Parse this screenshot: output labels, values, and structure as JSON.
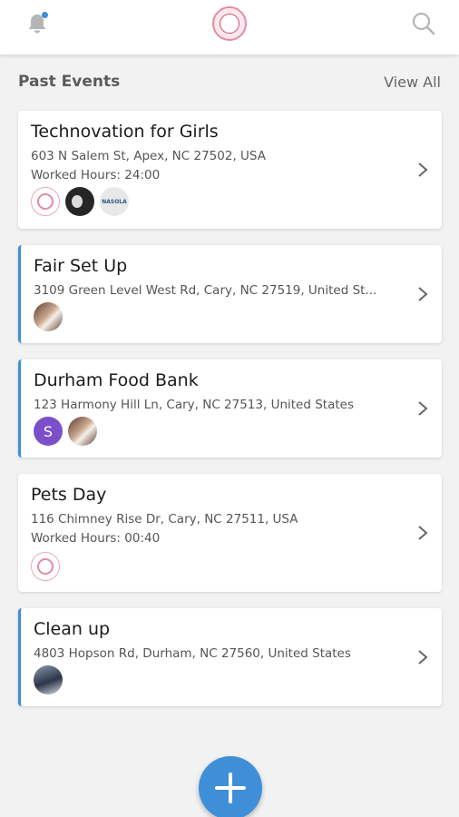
{
  "header": {
    "bell_icon": "bell-icon",
    "logo": "org-logo",
    "search_icon": "search-icon",
    "accent_color": "#3f8fd8"
  },
  "section": {
    "title": "Past Events",
    "view_all": "View All"
  },
  "events": [
    {
      "title": "Technovation for Girls",
      "address": "603 N Salem St, Apex, NC 27502, USA",
      "hours": "Worked Hours: 24:00",
      "participants": [
        "org-logo",
        "user-photo-dark",
        "NASOLA"
      ]
    },
    {
      "title": "Fair Set Up",
      "address": "3109 Green Level West Rd, Cary, NC  27519, United St...",
      "participants": [
        "user-photo"
      ]
    },
    {
      "title": "Durham Food Bank",
      "address": "123 Harmony Hill Ln, Cary, NC  27513, United States",
      "participants": [
        "S",
        "user-photo"
      ]
    },
    {
      "title": "Pets Day",
      "address": "116 Chimney Rise Dr, Cary, NC 27511, USA",
      "hours": "Worked Hours: 00:40",
      "participants": [
        "org-logo"
      ]
    },
    {
      "title": "Clean up",
      "address": "4803 Hopson Rd, Durham, NC  27560, United States",
      "participants": [
        "user-photo"
      ]
    }
  ],
  "fab": {
    "icon": "plus-icon",
    "color": "#3f8fd8"
  }
}
